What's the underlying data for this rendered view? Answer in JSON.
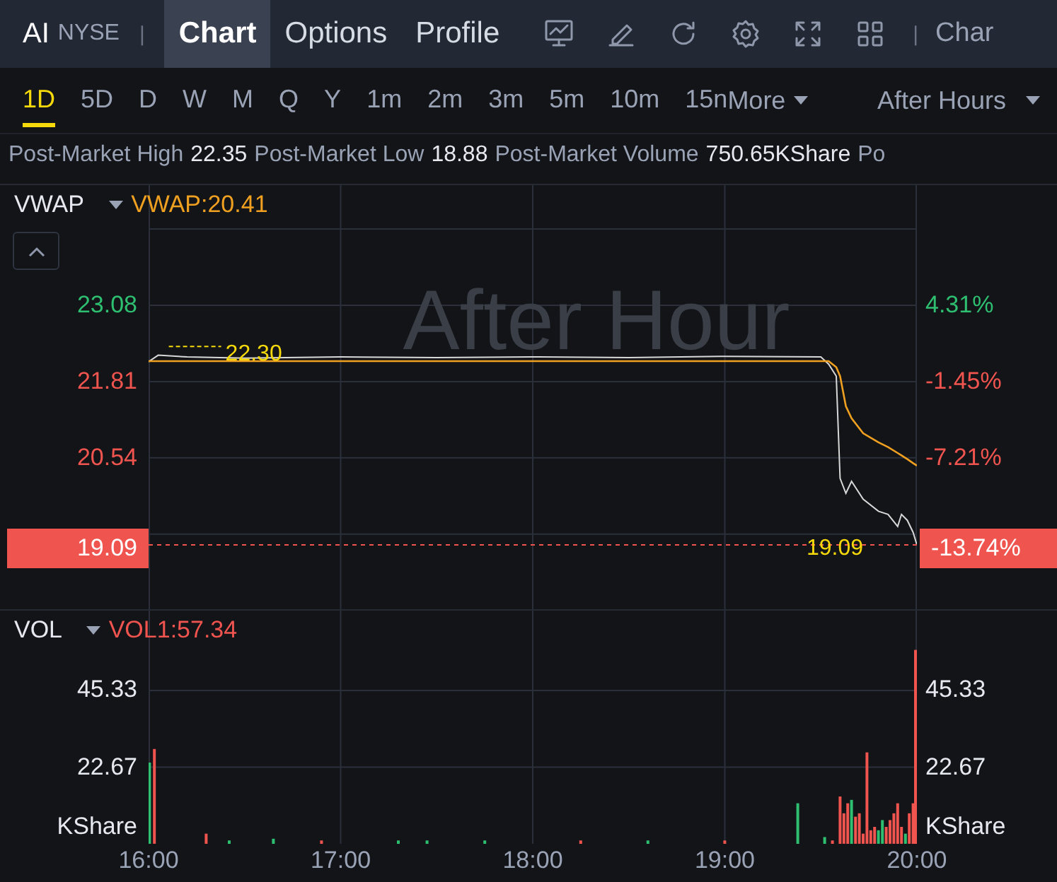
{
  "header": {
    "symbol": "AI",
    "exchange": "NYSE",
    "separator": "|",
    "tabs": [
      {
        "label": "Chart",
        "selected": true
      },
      {
        "label": "Options",
        "selected": false
      },
      {
        "label": "Profile",
        "selected": false
      }
    ],
    "tools": [
      {
        "kind": "monitor"
      },
      {
        "kind": "pen"
      },
      {
        "kind": "refresh"
      },
      {
        "kind": "gear"
      },
      {
        "kind": "expand"
      },
      {
        "kind": "grid"
      }
    ],
    "separator_2": "|",
    "cut_label": "Char"
  },
  "periods": [
    {
      "label": "1D",
      "selected": true
    },
    {
      "label": "5D",
      "selected": false
    },
    {
      "label": "D",
      "selected": false
    },
    {
      "label": "W",
      "selected": false
    },
    {
      "label": "M",
      "selected": false
    },
    {
      "label": "Q",
      "selected": false
    },
    {
      "label": "Y",
      "selected": false
    },
    {
      "label": "1m",
      "selected": false
    },
    {
      "label": "2m",
      "selected": false
    },
    {
      "label": "3m",
      "selected": false
    },
    {
      "label": "5m",
      "selected": false
    },
    {
      "label": "10m",
      "selected": false
    },
    {
      "label": "15n",
      "selected": false
    }
  ],
  "more": "More",
  "session": "After Hours",
  "stats": [
    {
      "label": "Post-Market High",
      "value": "22.35"
    },
    {
      "label": "Post-Market Low",
      "value": "18.88"
    },
    {
      "label": "Post-Market Volume",
      "value": "750.65KShare"
    },
    {
      "label": "Po"
    }
  ],
  "price_pane": {
    "indicator": "VWAP",
    "indicator_value": "VWAP:20.41",
    "watermark": "After Hour",
    "right_axis": [
      {
        "text": "4.31%",
        "kind": "up"
      },
      {
        "text": "-1.45%",
        "kind": "down"
      },
      {
        "text": "-7.21%",
        "kind": "down"
      },
      {
        "text": "-13.74%",
        "kind": "current"
      }
    ],
    "chart_data": {
      "type": "line",
      "grid": true,
      "xlim": [
        15.2265,
        20.7293
      ],
      "ylim": [
        18.02,
        25.08
      ],
      "yticks": [
        {
          "value": 23.08,
          "label": "23.08"
        },
        {
          "value": 21.81,
          "label": "21.81"
        },
        {
          "value": 20.54,
          "label": "20.54"
        },
        {
          "value": 19.09,
          "label": "19.09"
        }
      ],
      "x": [
        16,
        16.05,
        16.2,
        16.5,
        17,
        17.5,
        18,
        18.5,
        19,
        19.5,
        19.54,
        19.58,
        19.6,
        19.63,
        19.66,
        19.72,
        19.8,
        19.85,
        19.9,
        19.92,
        19.95,
        19.98,
        20
      ],
      "series": [
        {
          "color": "#d8d8d8",
          "values": [
            22.14,
            22.25,
            22.22,
            22.2,
            22.22,
            22.21,
            22.22,
            22.21,
            22.23,
            22.22,
            22.1,
            21.9,
            20.2,
            19.95,
            20.15,
            19.85,
            19.65,
            19.6,
            19.4,
            19.6,
            19.5,
            19.3,
            19.09
          ]
        },
        {
          "color": "#f0a020",
          "values": [
            22.15,
            22.15,
            22.15,
            22.15,
            22.15,
            22.15,
            22.15,
            22.15,
            22.15,
            22.15,
            22.15,
            22.05,
            21.9,
            21.4,
            21.2,
            20.95,
            20.8,
            20.72,
            20.62,
            20.58,
            20.52,
            20.45,
            20.41
          ]
        }
      ],
      "annotations": [
        {
          "x": 16.4,
          "y": 22.3,
          "text": "22.30"
        }
      ]
    },
    "last_price_note": "19.09"
  },
  "volume_pane": {
    "indicator": "VOL",
    "indicator_value": "VOL1:57.34",
    "unit_left": "KShare",
    "right_axis": [
      "45.33",
      "22.67"
    ],
    "unit_right": "KShare",
    "chart_data": {
      "type": "bar",
      "grid": true,
      "xlim": [
        15.2265,
        20.7293
      ],
      "ylim": [
        0,
        68.9
      ],
      "yticks": [
        {
          "value": 45.33,
          "label": "45.33"
        },
        {
          "value": 22.67,
          "label": "22.67"
        }
      ],
      "xticks": [
        {
          "value": 16,
          "label": "16:00"
        },
        {
          "value": 17,
          "label": "17:00"
        },
        {
          "value": 18,
          "label": "18:00"
        },
        {
          "value": 19,
          "label": "19:00"
        },
        {
          "value": 20,
          "label": "20:00"
        }
      ],
      "x": [
        16.005,
        16.03,
        16.3,
        16.42,
        16.65,
        16.9,
        17.3,
        17.45,
        17.75,
        18.25,
        18.6,
        19,
        19.38,
        19.52,
        19.56,
        19.6,
        19.62,
        19.64,
        19.66,
        19.68,
        19.7,
        19.72,
        19.74,
        19.76,
        19.78,
        19.8,
        19.82,
        19.84,
        19.86,
        19.88,
        19.9,
        19.92,
        19.94,
        19.96,
        19.98,
        19.995
      ],
      "series": [
        {
          "color": "#2fbf71",
          "values": [
            24,
            null,
            null,
            1,
            1.5,
            null,
            1,
            1,
            1,
            null,
            1,
            null,
            12,
            2,
            null,
            null,
            null,
            null,
            13,
            null,
            null,
            null,
            null,
            null,
            null,
            4,
            7,
            null,
            null,
            null,
            null,
            null,
            3,
            null,
            null,
            null
          ]
        },
        {
          "color": "#f0544f",
          "values": [
            null,
            28,
            3,
            null,
            null,
            1,
            null,
            null,
            null,
            1,
            null,
            1,
            null,
            null,
            1,
            14,
            9,
            12,
            null,
            8,
            9,
            3,
            27,
            4,
            5,
            null,
            null,
            5,
            7,
            9,
            12,
            5,
            null,
            9,
            12,
            57.3
          ]
        }
      ]
    }
  }
}
